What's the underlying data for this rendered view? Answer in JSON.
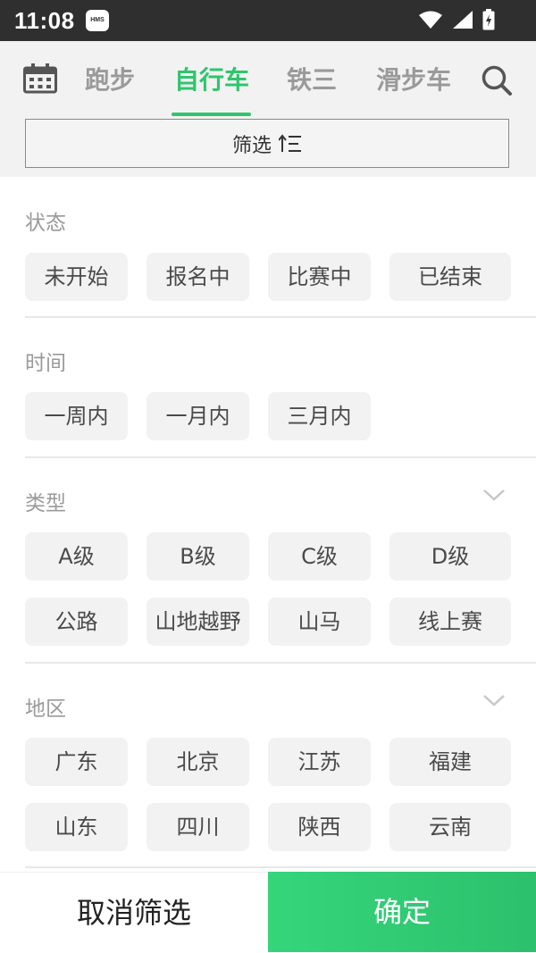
{
  "status_bar": {
    "time": "11:08",
    "badge": "HMS"
  },
  "nav": {
    "tabs": [
      {
        "label": "跑步"
      },
      {
        "label": "自行车"
      },
      {
        "label": "铁三"
      },
      {
        "label": "滑步车"
      }
    ]
  },
  "filter": {
    "label": "筛选"
  },
  "sections": {
    "status": {
      "title": "状态",
      "options": [
        "未开始",
        "报名中",
        "比赛中",
        "已结束"
      ]
    },
    "time": {
      "title": "时间",
      "options": [
        "一周内",
        "一月内",
        "三月内"
      ]
    },
    "type": {
      "title": "类型",
      "options": [
        "A级",
        "B级",
        "C级",
        "D级",
        "公路",
        "山地越野",
        "山马",
        "线上赛"
      ]
    },
    "region": {
      "title": "地区",
      "options": [
        "广东",
        "北京",
        "江苏",
        "福建",
        "山东",
        "四川",
        "陕西",
        "云南"
      ]
    }
  },
  "actions": {
    "cancel": "取消筛选",
    "confirm": "确定"
  },
  "colors": {
    "accent": "#2fc56d",
    "chip_bg": "#f2f2f2",
    "topbar_bg": "#f2f2f2"
  }
}
